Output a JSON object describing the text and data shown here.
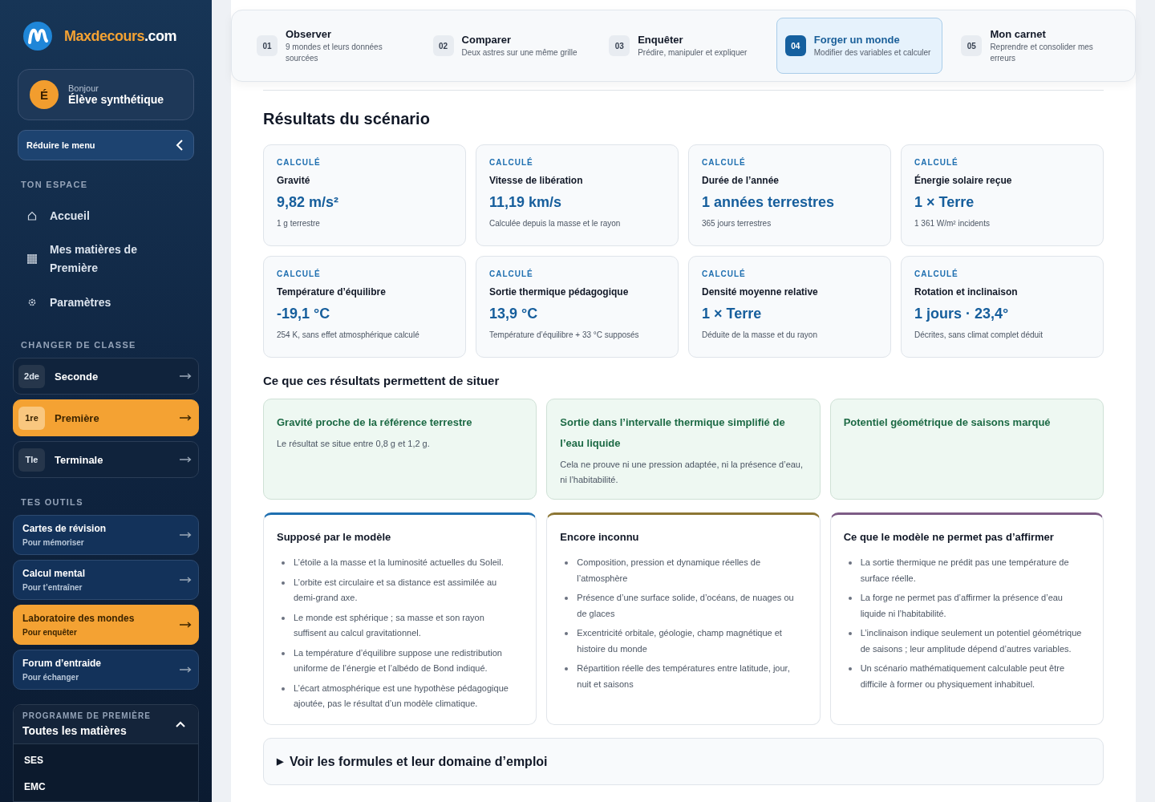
{
  "sidebar": {
    "logo": {
      "brand": "Maxdecours",
      "suffix": ".com"
    },
    "user": {
      "initial": "É",
      "greeting": "Bonjour",
      "name": "Élève synthétique"
    },
    "collapse_button": "Réduire le menu",
    "space_title": "TON ESPACE",
    "nav": [
      {
        "label": "Accueil"
      },
      {
        "label": "Mes matières de Première"
      },
      {
        "label": "Paramètres"
      }
    ],
    "class_title": "CHANGER DE CLASSE",
    "classes": [
      {
        "badge": "2de",
        "label": "Seconde",
        "selected": false
      },
      {
        "badge": "1re",
        "label": "Première",
        "selected": true
      },
      {
        "badge": "Tle",
        "label": "Terminale",
        "selected": false
      }
    ],
    "tools_title": "TES OUTILS",
    "tools": [
      {
        "label": "Cartes de révision",
        "sub": "Pour mémoriser",
        "selected": false
      },
      {
        "label": "Calcul mental",
        "sub": "Pour t’entraîner",
        "selected": false
      },
      {
        "label": "Laboratoire des mondes",
        "sub": "Pour enquêter",
        "selected": true
      },
      {
        "label": "Forum d’entraide",
        "sub": "Pour échanger",
        "selected": false
      }
    ],
    "program": {
      "overline": "PROGRAMME DE PREMIÈRE",
      "title": "Toutes les matières",
      "expanded": true,
      "subjects": [
        "SES",
        "EMC"
      ]
    }
  },
  "steps": [
    {
      "number": "01",
      "title": "Observer",
      "desc": "9 mondes et leurs données sourcées",
      "selected": false
    },
    {
      "number": "02",
      "title": "Comparer",
      "desc": "Deux astres sur une même grille",
      "selected": false
    },
    {
      "number": "03",
      "title": "Enquêter",
      "desc": "Prédire, manipuler et expliquer",
      "selected": false
    },
    {
      "number": "04",
      "title": "Forger un monde",
      "desc": "Modifier des variables et calculer",
      "selected": true
    },
    {
      "number": "05",
      "title": "Mon carnet",
      "desc": "Reprendre et consolider mes erreurs",
      "selected": false
    }
  ],
  "results_title": "Résultats du scénario",
  "results": [
    {
      "tag": "CALCULÉ",
      "label": "Gravité",
      "value": "9,82 m/s²",
      "note": "1 g terrestre"
    },
    {
      "tag": "CALCULÉ",
      "label": "Vitesse de libération",
      "value": "11,19 km/s",
      "note": "Calculée depuis la masse et le rayon"
    },
    {
      "tag": "CALCULÉ",
      "label": "Durée de l’année",
      "value": "1 années terrestres",
      "note": "365 jours terrestres"
    },
    {
      "tag": "CALCULÉ",
      "label": "Énergie solaire reçue",
      "value": "1 × Terre",
      "note": "1 361 W/m² incidents"
    },
    {
      "tag": "CALCULÉ",
      "label": "Température d’équilibre",
      "value": "-19,1 °C",
      "note": "254 K, sans effet atmosphérique calculé"
    },
    {
      "tag": "CALCULÉ",
      "label": "Sortie thermique pédagogique",
      "value": "13,9 °C",
      "note": "Température d’équilibre + 33 °C supposés"
    },
    {
      "tag": "CALCULÉ",
      "label": "Densité moyenne relative",
      "value": "1 × Terre",
      "note": "Déduite de la masse et du rayon"
    },
    {
      "tag": "CALCULÉ",
      "label": "Rotation et inclinaison",
      "value": "1 jours · 23,4°",
      "note": "Décrites, sans climat complet déduit"
    }
  ],
  "situate_title": "Ce que ces résultats permettent de situer",
  "situations": [
    {
      "title": "Gravité proche de la référence terrestre",
      "text": "Le résultat se situe entre 0,8 g et 1,2 g."
    },
    {
      "title": "Sortie dans l’intervalle thermique simplifié de l’eau liquide",
      "text": "Cela ne prouve ni une pression adaptée, ni la présence d’eau, ni l’habitabilité."
    },
    {
      "title": "Potentiel géométrique de saisons marqué"
    }
  ],
  "limits": [
    {
      "title": "Supposé par le modèle",
      "color": "#1f6fb0",
      "items": [
        "L’étoile a la masse et la luminosité actuelles du Soleil.",
        "L’orbite est circulaire et sa distance est assimilée au demi-grand axe.",
        "Le monde est sphérique ; sa masse et son rayon suffisent au calcul gravitationnel.",
        "La température d’équilibre suppose une redistribution uniforme de l’énergie et l’albédo de Bond indiqué.",
        "L’écart atmosphérique est une hypothèse pédagogique ajoutée, pas le résultat d’un modèle climatique."
      ]
    },
    {
      "title": "Encore inconnu",
      "color": "#8c7634",
      "items": [
        "Composition, pression et dynamique réelles de l’atmosphère",
        "Présence d’une surface solide, d’océans, de nuages ou de glaces",
        "Excentricité orbitale, géologie, champ magnétique et histoire du monde",
        "Répartition réelle des températures entre latitude, jour, nuit et saisons"
      ]
    },
    {
      "title": "Ce que le modèle ne permet pas d’affirmer",
      "color": "#7d5c86",
      "items": [
        "La sortie thermique ne prédit pas une température de surface réelle.",
        "La forge ne permet pas d’affirmer la présence d’eau liquide ni l’habitabilité.",
        "L’inclinaison indique seulement un potentiel géométrique de saisons ; leur amplitude dépend d’autres variables.",
        "Un scénario mathématiquement calculable peut être difficile à former ou physiquement inhabituel."
      ]
    }
  ],
  "formulas": {
    "toggle": "▶",
    "label": "Voir les formules et leur domaine d’emploi",
    "expanded": false
  }
}
